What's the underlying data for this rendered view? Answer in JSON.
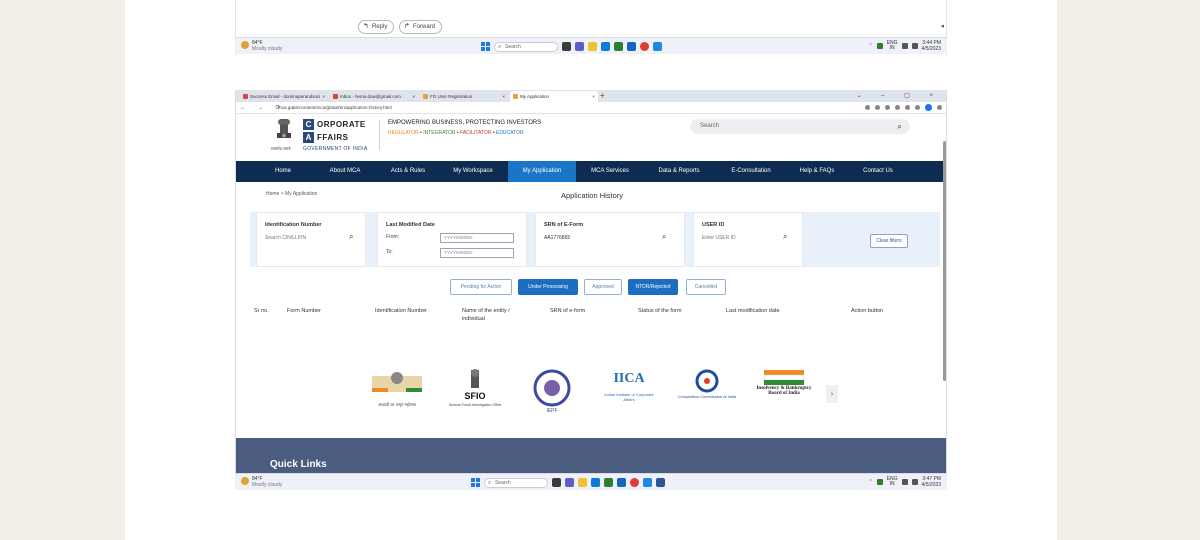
{
  "email_fragment": {
    "reply_label": "Reply",
    "forward_label": "Forward"
  },
  "taskbar_top": {
    "weather_temp": "84°F",
    "weather_desc": "Mostly cloudy",
    "search_placeholder": "Search",
    "lang": "ENG",
    "lang_sub": "IN",
    "time": "3:44 PM",
    "date": "4/5/2023"
  },
  "taskbar_bottom": {
    "weather_temp": "84°F",
    "weather_desc": "Mostly cloudy",
    "search_placeholder": "Search",
    "lang": "ENG",
    "lang_sub": "IN",
    "time": "3:47 PM",
    "date": "4/5/2023"
  },
  "browser": {
    "tabs": [
      {
        "label": "Success Email - dominaperandsoci",
        "color": "#d44638"
      },
      {
        "label": "Inbox - hema.dow@gmail.com",
        "color": "#d44638"
      },
      {
        "label": "FO User Registration",
        "color": "#e6a23c"
      },
      {
        "label": "My Application",
        "color": "#e6a23c"
      }
    ],
    "url": "mca.gov.in/content/mca/global/en/application-history.html"
  },
  "header": {
    "emblem_caption": "सत्यमेव जयते",
    "logo_line1": "ORPORATE",
    "logo_line2": "FFAIRS",
    "logo_c": "C",
    "logo_a": "A",
    "government": "GOVERNMENT OF INDIA",
    "tagline": "EMPOWERING BUSINESS, PROTECTING INVESTORS",
    "pillars": [
      "REGULATOR",
      "INTEGRATOR",
      "FACILITATOR",
      "EDUCATOR"
    ],
    "search_placeholder": "Search"
  },
  "nav": {
    "items": [
      "Home",
      "About MCA",
      "Acts & Rules",
      "My Workspace",
      "My Application",
      "MCA Services",
      "Data & Reports",
      "E-Consultation",
      "Help & FAQs",
      "Contact Us"
    ],
    "active": "My Application"
  },
  "breadcrumb": "Home > My Application",
  "page_title": "Application History",
  "filters": {
    "identification_label": "Identification Number",
    "identification_placeholder": "Search CIN/LLPIN",
    "last_modified_label": "Last Modified Date",
    "from_label": "From:",
    "to_label": "To:",
    "date_placeholder": "YYYY/MM/DD",
    "srn_label": "SRN of E-Form",
    "srn_value": "AA1776865",
    "user_id_label": "USER ID",
    "user_id_placeholder": "Enter USER ID",
    "clear_label": "Clear filters"
  },
  "status_buttons": [
    "Pending for Action",
    "Under Processing",
    "Approved",
    "NTDR/Rejected",
    "Cancelled"
  ],
  "table_columns": [
    "Sr no.",
    "Form Number",
    "Identification Number",
    "Name of the entity / individual",
    "SRN of e-form",
    "Status of the form",
    "Last modification date",
    "Action button"
  ],
  "partners": {
    "logo1_caption": "आज़ादी का अमृत महोत्सव",
    "sfio": "SFIO",
    "sfio_sub": "Serious Fraud Investigation Office",
    "iepf": "IEPF",
    "iica": "IICA",
    "iica_sub": "Indian Institute of Corporate Affairs",
    "cci": "Competition Commission of India",
    "ibbi": "Insolvency & Bankruptcy Board of India"
  },
  "quick_links": "Quick Links",
  "colors": {
    "nav_bg": "#0e2c52",
    "nav_active": "#1a75c7",
    "button_blue": "#1c6fc0",
    "quicklinks_bg": "#4b5d7e"
  }
}
